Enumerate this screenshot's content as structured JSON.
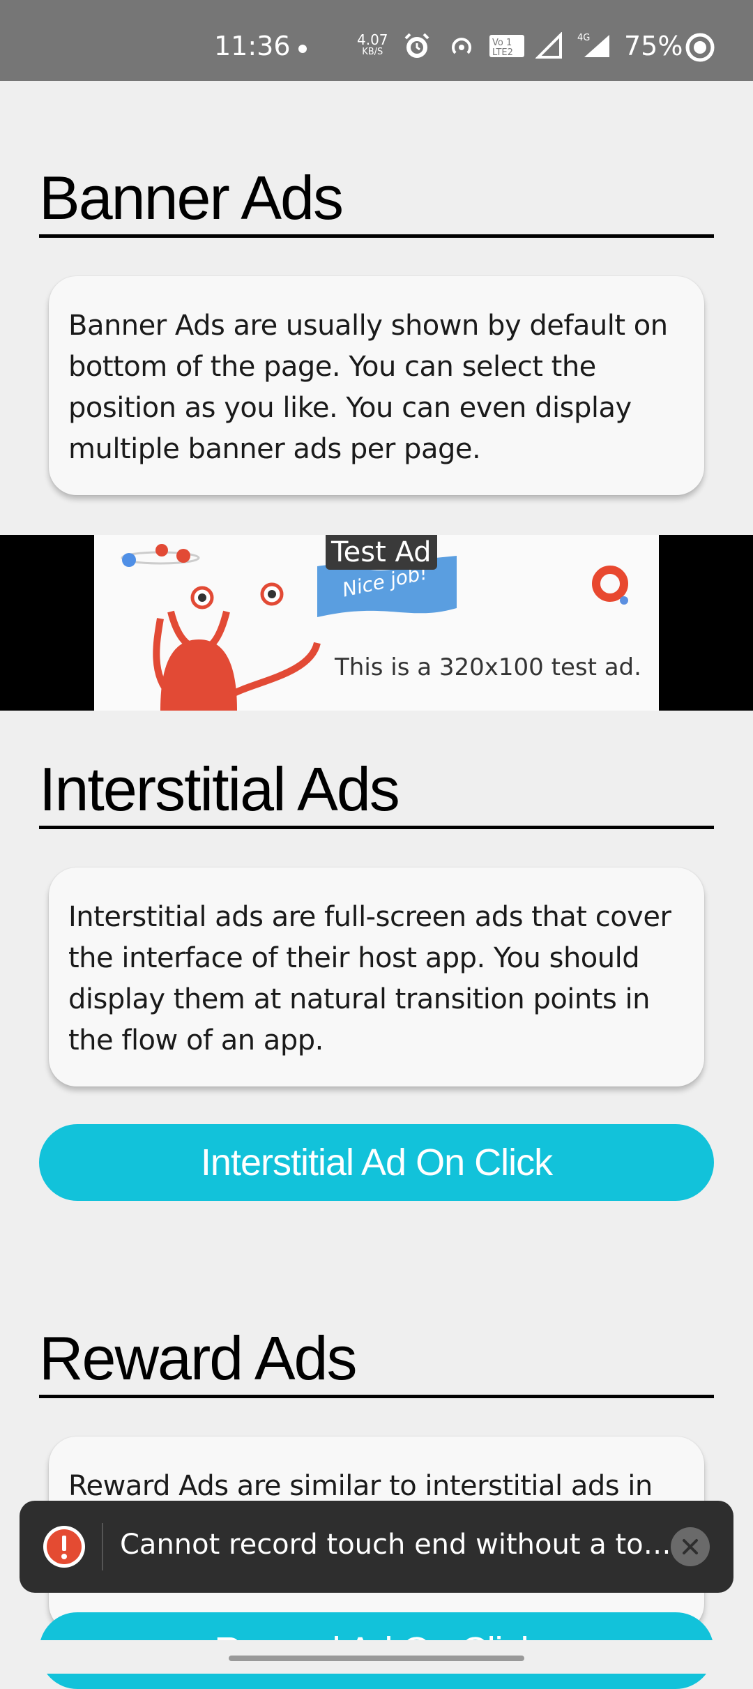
{
  "status_bar": {
    "time": "11:36",
    "speed_value": "4.07",
    "speed_unit": "KB/S",
    "battery": "75%"
  },
  "sections": {
    "banner": {
      "title": "Banner Ads",
      "description": "Banner Ads are usually shown by default on bottom of the page. You can select the position as you like. You can even display multiple banner ads per page."
    },
    "interstitial": {
      "title": "Interstitial Ads",
      "description": "Interstitial ads are full-screen ads that cover the interface of their host app. You should display them at natural transition points in the flow of an app.",
      "button_label": "Interstitial Ad On Click"
    },
    "reward": {
      "title": "Reward Ads",
      "description": "Reward Ads are similar to interstitial ads in the",
      "button_label": "Reward Ad On Click"
    }
  },
  "test_ad": {
    "label": "Test Ad",
    "flag_text": "Nice job!",
    "caption": "This is a 320x100 test ad."
  },
  "toast": {
    "message": "Cannot record touch end without a touch s..."
  },
  "colors": {
    "accent": "#12c2da",
    "toast_bg": "#2e2e2e",
    "error": "#e44b32"
  }
}
